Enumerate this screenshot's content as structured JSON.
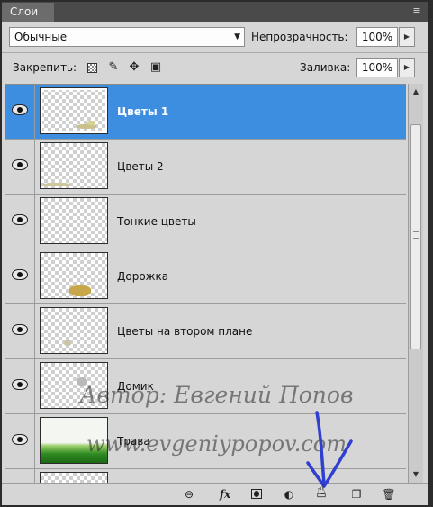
{
  "panel": {
    "tab_label": "Слои",
    "menu_icon": "panel-menu-icon"
  },
  "blend": {
    "mode": "Обычные",
    "opacity_label": "Непрозрачность:",
    "opacity_value": "100%"
  },
  "lock": {
    "label": "Закрепить:",
    "icons": [
      "lock-transparent-icon",
      "lock-brush-icon",
      "lock-move-icon",
      "lock-all-icon"
    ],
    "fill_label": "Заливка:",
    "fill_value": "100%"
  },
  "layers": [
    {
      "name": "Цветы 1",
      "selected": true,
      "visible": true
    },
    {
      "name": "Цветы 2",
      "selected": false,
      "visible": true
    },
    {
      "name": "Тонкие цветы",
      "selected": false,
      "visible": true
    },
    {
      "name": "Дорожка",
      "selected": false,
      "visible": true
    },
    {
      "name": "Цветы на втором плане",
      "selected": false,
      "visible": true
    },
    {
      "name": "Домик",
      "selected": false,
      "visible": true
    },
    {
      "name": "Трава",
      "selected": false,
      "visible": true
    }
  ],
  "watermark": {
    "line1": "Автор: Евгений Попов",
    "line2": "www.evgeniypopov.com"
  },
  "colors": {
    "selection": "#3d8de0",
    "panel_bg": "#d6d6d6",
    "annotation": "#2f3fd0"
  },
  "toolbar": {
    "icons": [
      "link-layers-icon",
      "fx-icon",
      "layer-mask-icon",
      "adjustment-layer-icon",
      "new-group-icon",
      "new-layer-icon",
      "delete-icon"
    ],
    "fx_label": "fx"
  }
}
